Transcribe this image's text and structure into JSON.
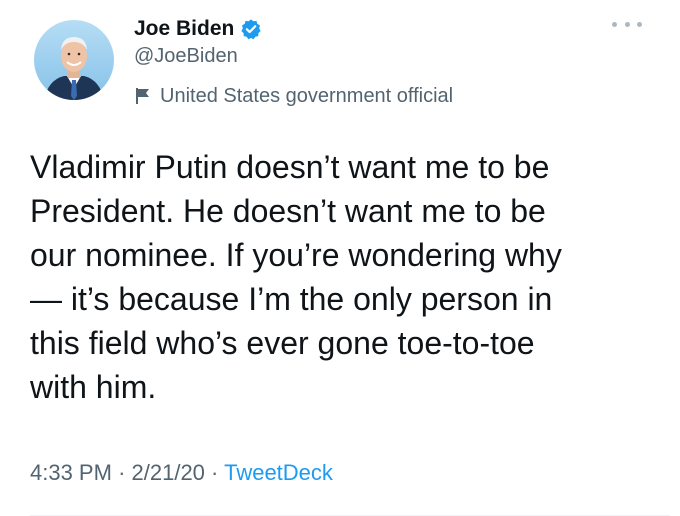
{
  "author": {
    "display_name": "Joe Biden",
    "handle": "@JoeBiden",
    "verified": true,
    "label": "United States government official"
  },
  "icons": {
    "avatar": "avatar-photo",
    "verified": "verified-badge-icon",
    "label": "flag-icon",
    "menu": "more-options-icon"
  },
  "tweet": {
    "text": "Vladimir Putin doesn’t want me to be\nPresident. He doesn’t want me to be\nour nominee. If you’re wondering why\n— it’s because I’m the only person in\nthis field who’s ever gone toe-to-toe\nwith him.",
    "time": "4:33 PM",
    "separator": "·",
    "date": "2/21/20",
    "source": "TweetDeck"
  },
  "colors": {
    "text": "#0f1419",
    "secondary": "#536471",
    "link": "#1d9bf0",
    "verified": "#1d9bf0",
    "avatar_bg": "#9fcfee"
  }
}
